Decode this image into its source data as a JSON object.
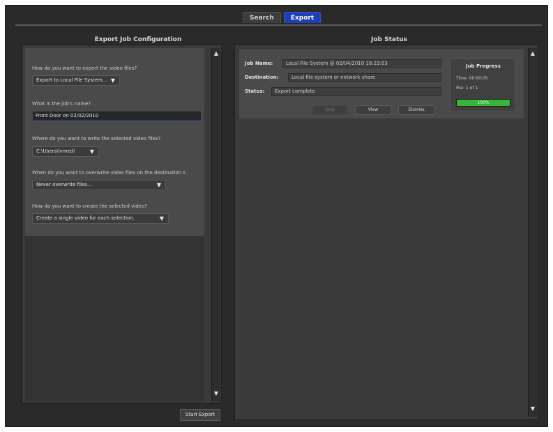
{
  "tabs": [
    {
      "label": "Search",
      "active": false
    },
    {
      "label": "Export",
      "active": true
    }
  ],
  "config": {
    "title": "Export Job Configuration",
    "questions": [
      {
        "question": "How do you want to export the video files?",
        "type": "select",
        "value": "Export to Local File System..."
      },
      {
        "question": "What is the job's name?",
        "type": "text",
        "value": "Front Door on 02/02/2010"
      },
      {
        "question": "Where do you want to write the selected video files?",
        "type": "select",
        "value": "C:\\Users\\lvmedi"
      },
      {
        "question": "When do you want to overwrite video files on the destination s",
        "type": "select",
        "value": "Never overwrite files..."
      },
      {
        "question": "How do you want to create the selected video?",
        "type": "select",
        "value": "Create a single video for each selection."
      }
    ],
    "start_button": "Start Export"
  },
  "status": {
    "title": "Job Status",
    "job_name_label": "Job Name:",
    "job_name": "Local File System @ 02/04/2010 16:23:03",
    "destination_label": "Destination:",
    "destination": "Local file system or network share",
    "status_label": "Status:",
    "status": "Export complete",
    "buttons": [
      "Stop",
      "View",
      "Dismiss"
    ],
    "progress": {
      "title": "Job Progress",
      "time_label": "Time:",
      "time": "00:00:05",
      "file_label": "File:",
      "file": "1 of 1",
      "percent_text": "100%",
      "fraction": 1.0,
      "bar_color": "#37b43a"
    }
  },
  "colors": {
    "accent": "#1f3fb8",
    "background": "#2a2a2a",
    "panel": "#4a4a4a"
  }
}
